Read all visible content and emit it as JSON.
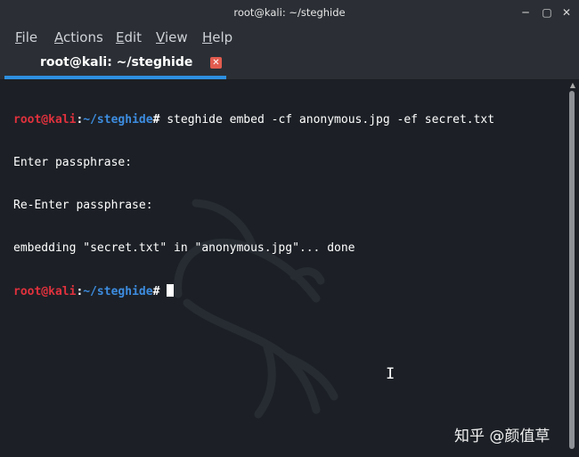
{
  "window": {
    "title": "root@kali: ~/steghide"
  },
  "controls": {
    "minimize": "─",
    "maximize": "▢",
    "close": "✕"
  },
  "menu": {
    "file": {
      "mnemonic": "F",
      "rest": "ile"
    },
    "actions": {
      "mnemonic": "A",
      "rest": "ctions"
    },
    "edit": {
      "mnemonic": "E",
      "rest": "dit"
    },
    "view": {
      "mnemonic": "V",
      "rest": "iew"
    },
    "help": {
      "mnemonic": "H",
      "rest": "elp"
    }
  },
  "tab": {
    "label": "root@kali: ~/steghide",
    "close": "✕",
    "accent_color": "#2e8fe0"
  },
  "terminal": {
    "prompt": {
      "user": "root@kali",
      "sep": ":",
      "path": "~/steghide",
      "symbol": "# "
    },
    "command": "steghide embed -cf anonymous.jpg -ef secret.txt",
    "out1": "Enter passphrase:",
    "out2": "Re-Enter passphrase:",
    "out3": "embedding \"secret.txt\" in \"anonymous.jpg\"... done",
    "colors": {
      "user": "#e0313d",
      "path": "#3d8ce0",
      "background": "#1c2026"
    }
  },
  "scrollbar": {
    "up_arrow": "▲"
  },
  "watermark": "知乎 @颜值草",
  "icons": [
    "close-icon",
    "minimize-icon",
    "maximize-icon",
    "tab-close-icon",
    "kali-dragon-icon",
    "ibeam-cursor-icon"
  ]
}
